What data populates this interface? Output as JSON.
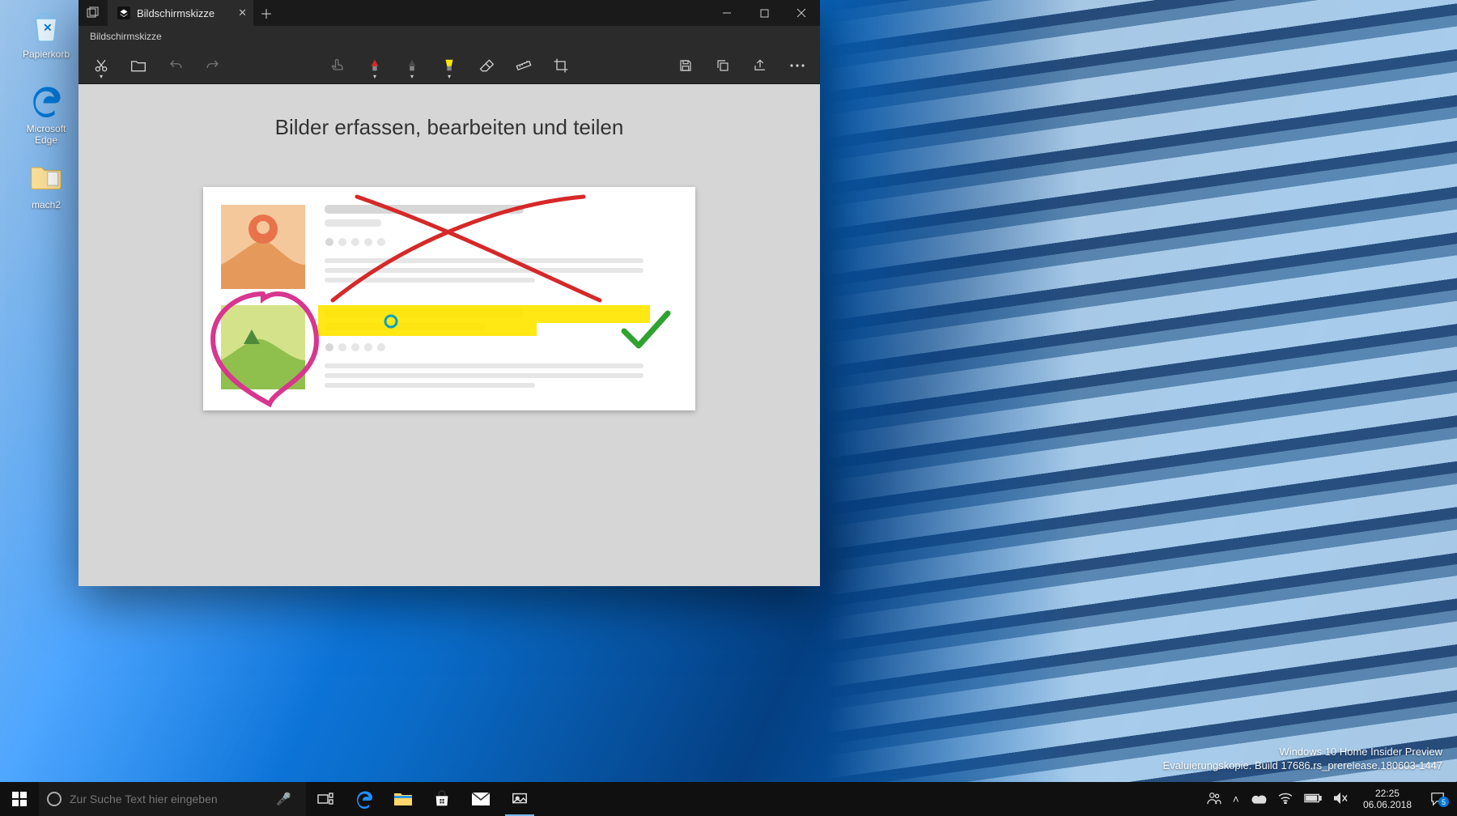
{
  "desktop_icons": [
    {
      "id": "recycle-bin",
      "label": "Papierkorb"
    },
    {
      "id": "edge",
      "label": "Microsoft Edge"
    },
    {
      "id": "mach2",
      "label": "mach2"
    }
  ],
  "watermark": {
    "line1": "Windows 10 Home Insider Preview",
    "line2": "Evaluierungskopie. Build 17686.rs_prerelease.180603-1447"
  },
  "window": {
    "tab_title": "Bildschirmskizze",
    "subtitle": "Bildschirmskizze",
    "heading": "Bilder erfassen, bearbeiten und teilen",
    "toolbar": {
      "new_snip": "Neu",
      "open": "Öffnen",
      "undo": "Rückgängig",
      "redo": "Wiederholen",
      "touch_writing": "Touchscreenhandschrift",
      "pen_red": "Kugelschreiber (rot)",
      "pen_black": "Bleistift",
      "highlighter": "Textmarker",
      "eraser": "Radierer",
      "ruler": "Lineal",
      "crop": "Zuschneiden",
      "save": "Speichern",
      "copy": "Kopieren",
      "share": "Teilen",
      "more": "Mehr"
    },
    "controls": {
      "minimize": "Minimieren",
      "maximize": "Maximieren",
      "close": "Schließen"
    }
  },
  "taskbar": {
    "search_placeholder": "Zur Suche Text hier eingeben"
  },
  "tray": {
    "time": "22:25",
    "date": "06.06.2018",
    "notification_count": "5"
  },
  "colors": {
    "pen_red": "#d62828",
    "pen_black": "#4a4a4a",
    "highlighter": "#ffe600",
    "heart": "#d8368f",
    "check": "#2fa32f"
  }
}
